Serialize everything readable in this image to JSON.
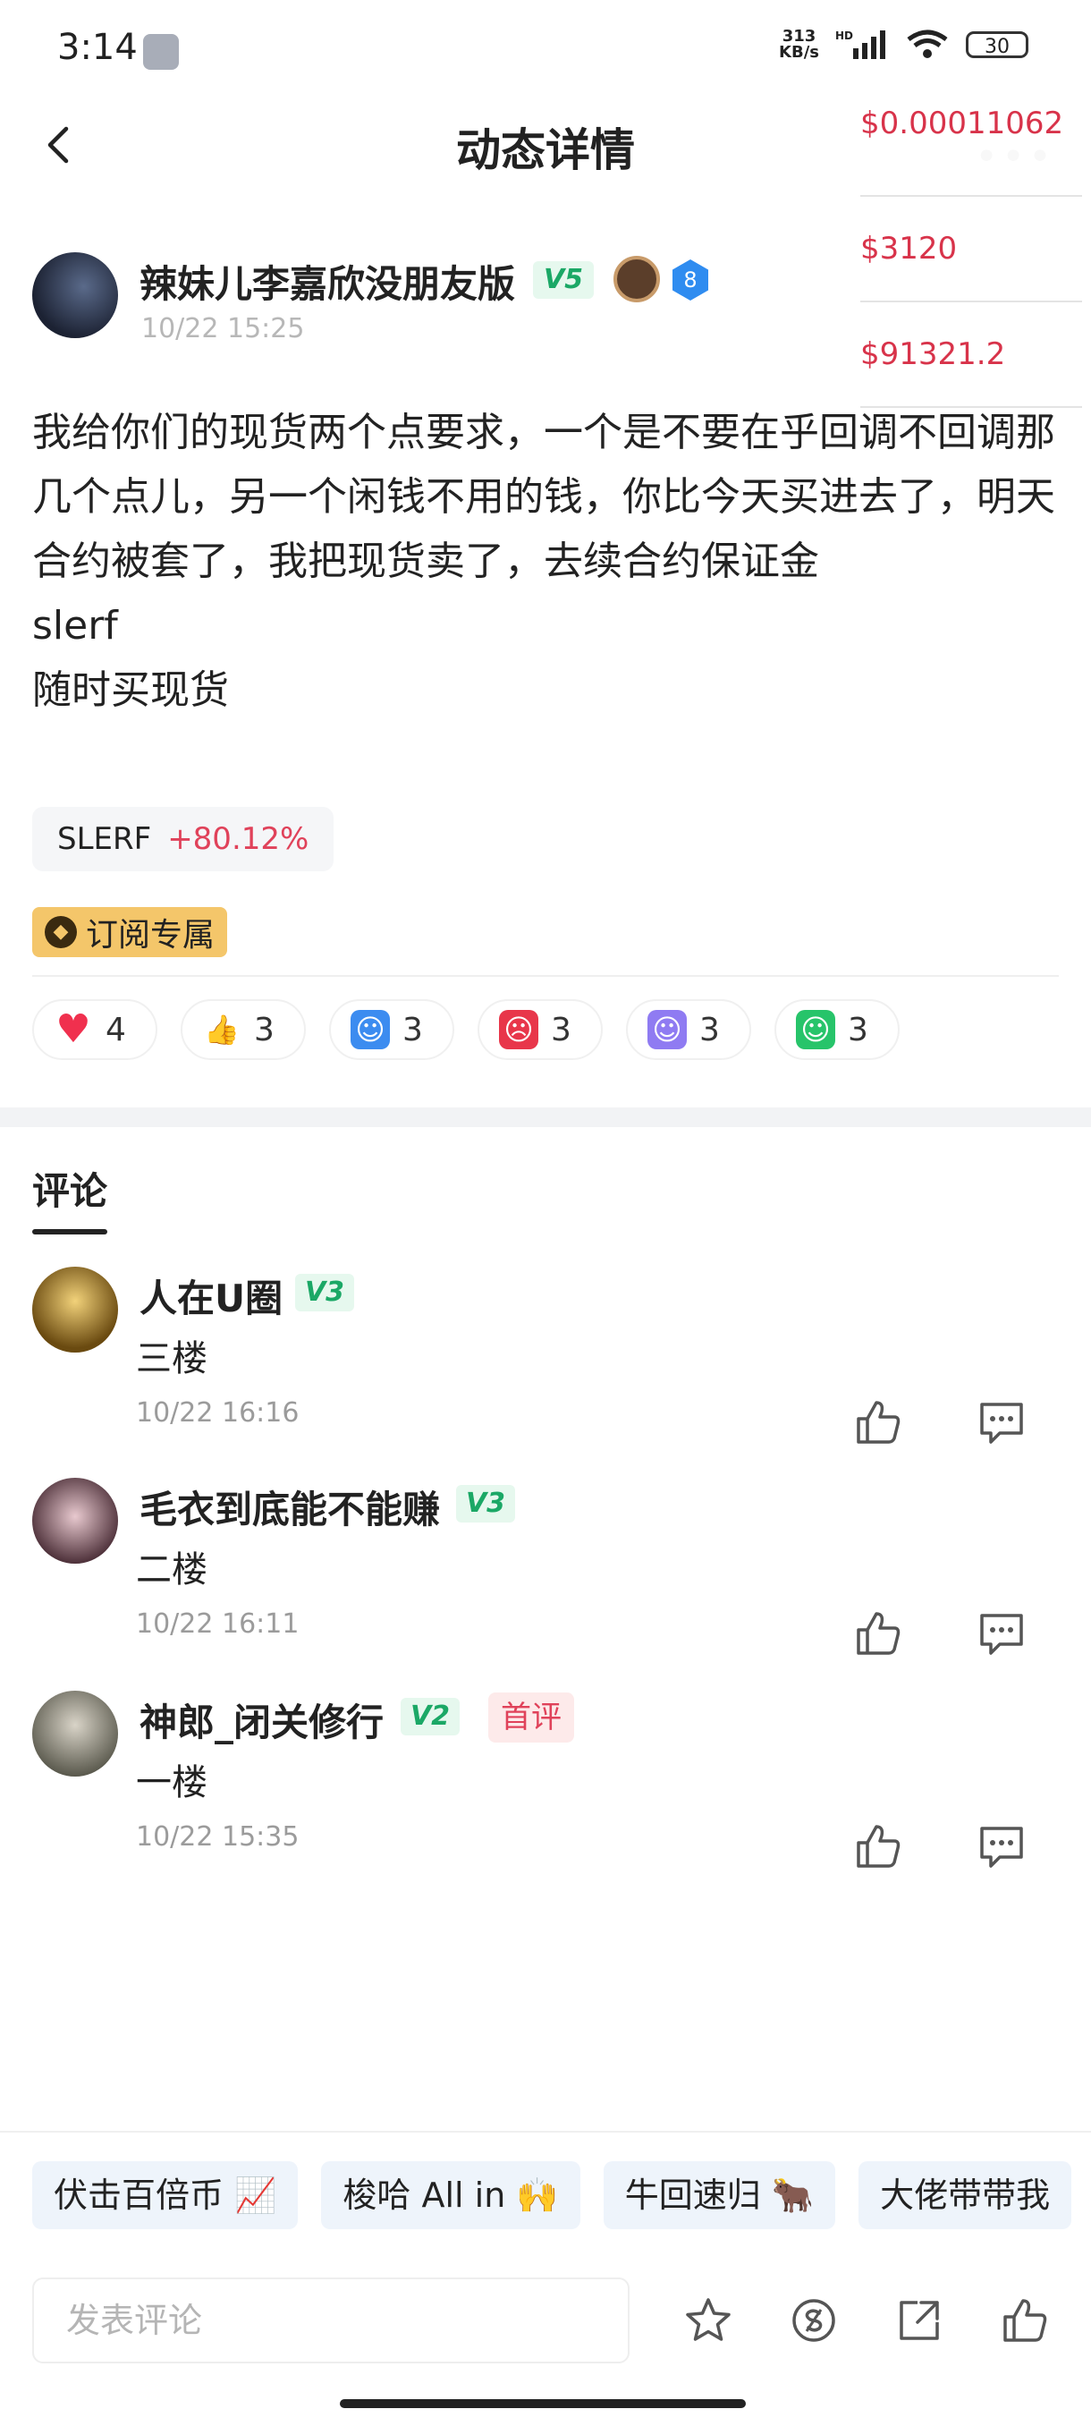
{
  "status_bar": {
    "time": "3:14",
    "net_speed_value": "313",
    "net_speed_unit": "KB/s",
    "hd": "HD",
    "battery": "30"
  },
  "header": {
    "title": "动态详情",
    "more": "•••"
  },
  "tickers": [
    "$0.00011062",
    "$3120",
    "$91321.2"
  ],
  "post": {
    "author": "辣妹儿李嘉欣没朋友版",
    "level_badge": "V5",
    "rank": "8",
    "time": "10/22 15:25",
    "lines": [
      "我给你们的现货两个点要求，一个是不要在乎回调不回调那几个点儿，另一个闲钱不用的钱，你比今天买进去了，明天合约被套了，我把现货卖了，去续合约保证金",
      "slerf",
      "随时买现货"
    ],
    "coin": {
      "name": "SLERF",
      "change": "+80.12%"
    },
    "subscription_tag": "订阅专属",
    "reactions": [
      {
        "icon": "heart-icon",
        "glyph": "♥",
        "count": "4",
        "color": "#f0304e"
      },
      {
        "icon": "thumbs-up-emoji-icon",
        "glyph": "👍",
        "count": "3",
        "color": "#ffd54a"
      },
      {
        "icon": "hodl-face-icon",
        "glyph": "☺",
        "count": "3",
        "color": "#3c8cf0"
      },
      {
        "icon": "angry-face-icon",
        "glyph": "☹",
        "count": "3",
        "color": "#e8364a"
      },
      {
        "icon": "shocked-face-icon",
        "glyph": "☺",
        "count": "3",
        "color": "#8f7bf2"
      },
      {
        "icon": "sick-face-icon",
        "glyph": "☺",
        "count": "3",
        "color": "#27c46a"
      }
    ]
  },
  "comments_tab": "评论",
  "comments": [
    {
      "name": "人在U圈",
      "level": "V3",
      "text": "三楼",
      "time": "10/22 16:16",
      "first": ""
    },
    {
      "name": "毛衣到底能不能赚",
      "level": "V3",
      "text": "二楼",
      "time": "10/22 16:11",
      "first": ""
    },
    {
      "name": "神郎_闭关修行",
      "level": "V2",
      "text": "一楼",
      "time": "10/22 15:35",
      "first": "首评"
    }
  ],
  "quick_replies": [
    "伏击百倍币 📈",
    "梭哈 All in 🙌",
    "牛回速归 🐂",
    "大佬带带我"
  ],
  "input_placeholder": "发表评论"
}
